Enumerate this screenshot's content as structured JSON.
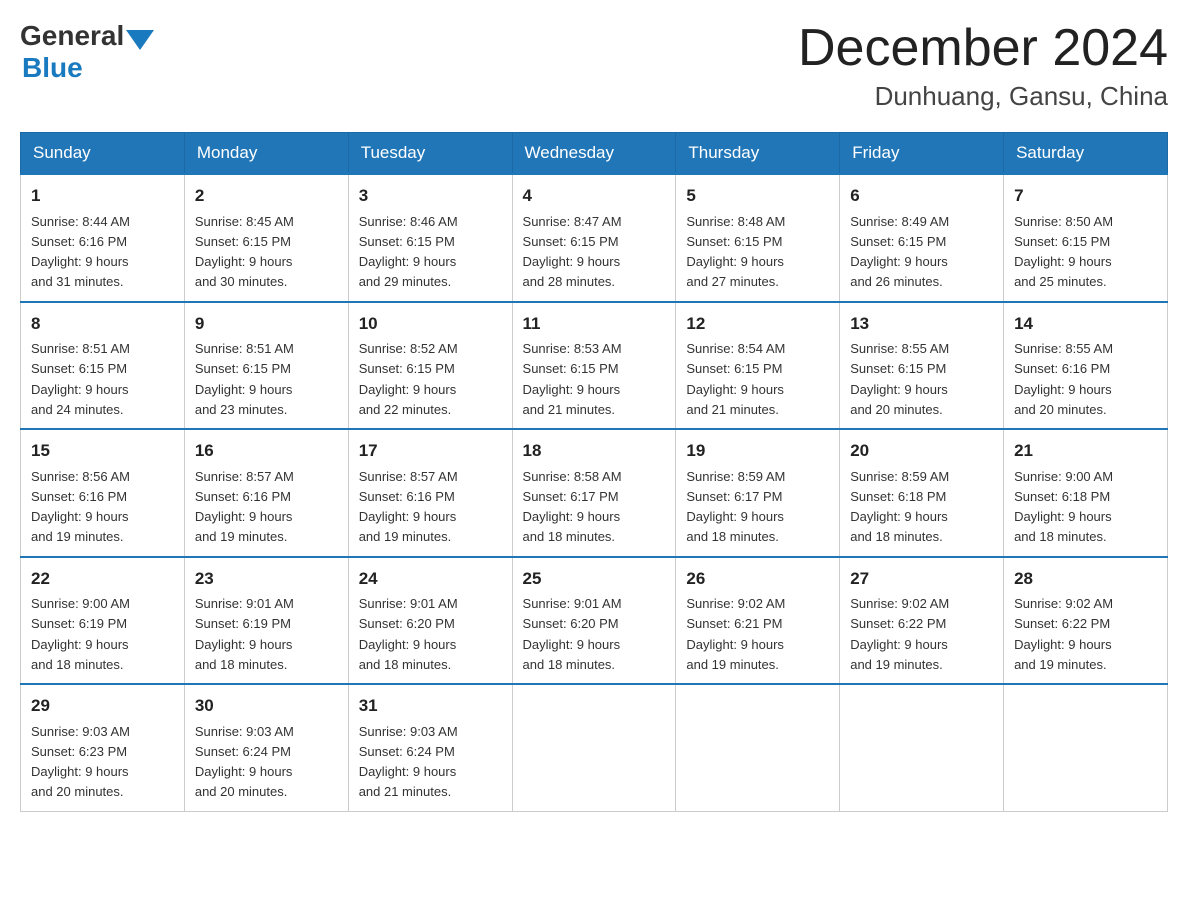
{
  "logo": {
    "general": "General",
    "blue": "Blue"
  },
  "header": {
    "month": "December 2024",
    "location": "Dunhuang, Gansu, China"
  },
  "weekdays": [
    "Sunday",
    "Monday",
    "Tuesday",
    "Wednesday",
    "Thursday",
    "Friday",
    "Saturday"
  ],
  "weeks": [
    [
      {
        "day": "1",
        "sunrise": "8:44 AM",
        "sunset": "6:16 PM",
        "daylight": "9 hours and 31 minutes."
      },
      {
        "day": "2",
        "sunrise": "8:45 AM",
        "sunset": "6:15 PM",
        "daylight": "9 hours and 30 minutes."
      },
      {
        "day": "3",
        "sunrise": "8:46 AM",
        "sunset": "6:15 PM",
        "daylight": "9 hours and 29 minutes."
      },
      {
        "day": "4",
        "sunrise": "8:47 AM",
        "sunset": "6:15 PM",
        "daylight": "9 hours and 28 minutes."
      },
      {
        "day": "5",
        "sunrise": "8:48 AM",
        "sunset": "6:15 PM",
        "daylight": "9 hours and 27 minutes."
      },
      {
        "day": "6",
        "sunrise": "8:49 AM",
        "sunset": "6:15 PM",
        "daylight": "9 hours and 26 minutes."
      },
      {
        "day": "7",
        "sunrise": "8:50 AM",
        "sunset": "6:15 PM",
        "daylight": "9 hours and 25 minutes."
      }
    ],
    [
      {
        "day": "8",
        "sunrise": "8:51 AM",
        "sunset": "6:15 PM",
        "daylight": "9 hours and 24 minutes."
      },
      {
        "day": "9",
        "sunrise": "8:51 AM",
        "sunset": "6:15 PM",
        "daylight": "9 hours and 23 minutes."
      },
      {
        "day": "10",
        "sunrise": "8:52 AM",
        "sunset": "6:15 PM",
        "daylight": "9 hours and 22 minutes."
      },
      {
        "day": "11",
        "sunrise": "8:53 AM",
        "sunset": "6:15 PM",
        "daylight": "9 hours and 21 minutes."
      },
      {
        "day": "12",
        "sunrise": "8:54 AM",
        "sunset": "6:15 PM",
        "daylight": "9 hours and 21 minutes."
      },
      {
        "day": "13",
        "sunrise": "8:55 AM",
        "sunset": "6:15 PM",
        "daylight": "9 hours and 20 minutes."
      },
      {
        "day": "14",
        "sunrise": "8:55 AM",
        "sunset": "6:16 PM",
        "daylight": "9 hours and 20 minutes."
      }
    ],
    [
      {
        "day": "15",
        "sunrise": "8:56 AM",
        "sunset": "6:16 PM",
        "daylight": "9 hours and 19 minutes."
      },
      {
        "day": "16",
        "sunrise": "8:57 AM",
        "sunset": "6:16 PM",
        "daylight": "9 hours and 19 minutes."
      },
      {
        "day": "17",
        "sunrise": "8:57 AM",
        "sunset": "6:16 PM",
        "daylight": "9 hours and 19 minutes."
      },
      {
        "day": "18",
        "sunrise": "8:58 AM",
        "sunset": "6:17 PM",
        "daylight": "9 hours and 18 minutes."
      },
      {
        "day": "19",
        "sunrise": "8:59 AM",
        "sunset": "6:17 PM",
        "daylight": "9 hours and 18 minutes."
      },
      {
        "day": "20",
        "sunrise": "8:59 AM",
        "sunset": "6:18 PM",
        "daylight": "9 hours and 18 minutes."
      },
      {
        "day": "21",
        "sunrise": "9:00 AM",
        "sunset": "6:18 PM",
        "daylight": "9 hours and 18 minutes."
      }
    ],
    [
      {
        "day": "22",
        "sunrise": "9:00 AM",
        "sunset": "6:19 PM",
        "daylight": "9 hours and 18 minutes."
      },
      {
        "day": "23",
        "sunrise": "9:01 AM",
        "sunset": "6:19 PM",
        "daylight": "9 hours and 18 minutes."
      },
      {
        "day": "24",
        "sunrise": "9:01 AM",
        "sunset": "6:20 PM",
        "daylight": "9 hours and 18 minutes."
      },
      {
        "day": "25",
        "sunrise": "9:01 AM",
        "sunset": "6:20 PM",
        "daylight": "9 hours and 18 minutes."
      },
      {
        "day": "26",
        "sunrise": "9:02 AM",
        "sunset": "6:21 PM",
        "daylight": "9 hours and 19 minutes."
      },
      {
        "day": "27",
        "sunrise": "9:02 AM",
        "sunset": "6:22 PM",
        "daylight": "9 hours and 19 minutes."
      },
      {
        "day": "28",
        "sunrise": "9:02 AM",
        "sunset": "6:22 PM",
        "daylight": "9 hours and 19 minutes."
      }
    ],
    [
      {
        "day": "29",
        "sunrise": "9:03 AM",
        "sunset": "6:23 PM",
        "daylight": "9 hours and 20 minutes."
      },
      {
        "day": "30",
        "sunrise": "9:03 AM",
        "sunset": "6:24 PM",
        "daylight": "9 hours and 20 minutes."
      },
      {
        "day": "31",
        "sunrise": "9:03 AM",
        "sunset": "6:24 PM",
        "daylight": "9 hours and 21 minutes."
      },
      null,
      null,
      null,
      null
    ]
  ],
  "labels": {
    "sunrise": "Sunrise:",
    "sunset": "Sunset:",
    "daylight": "Daylight:"
  }
}
